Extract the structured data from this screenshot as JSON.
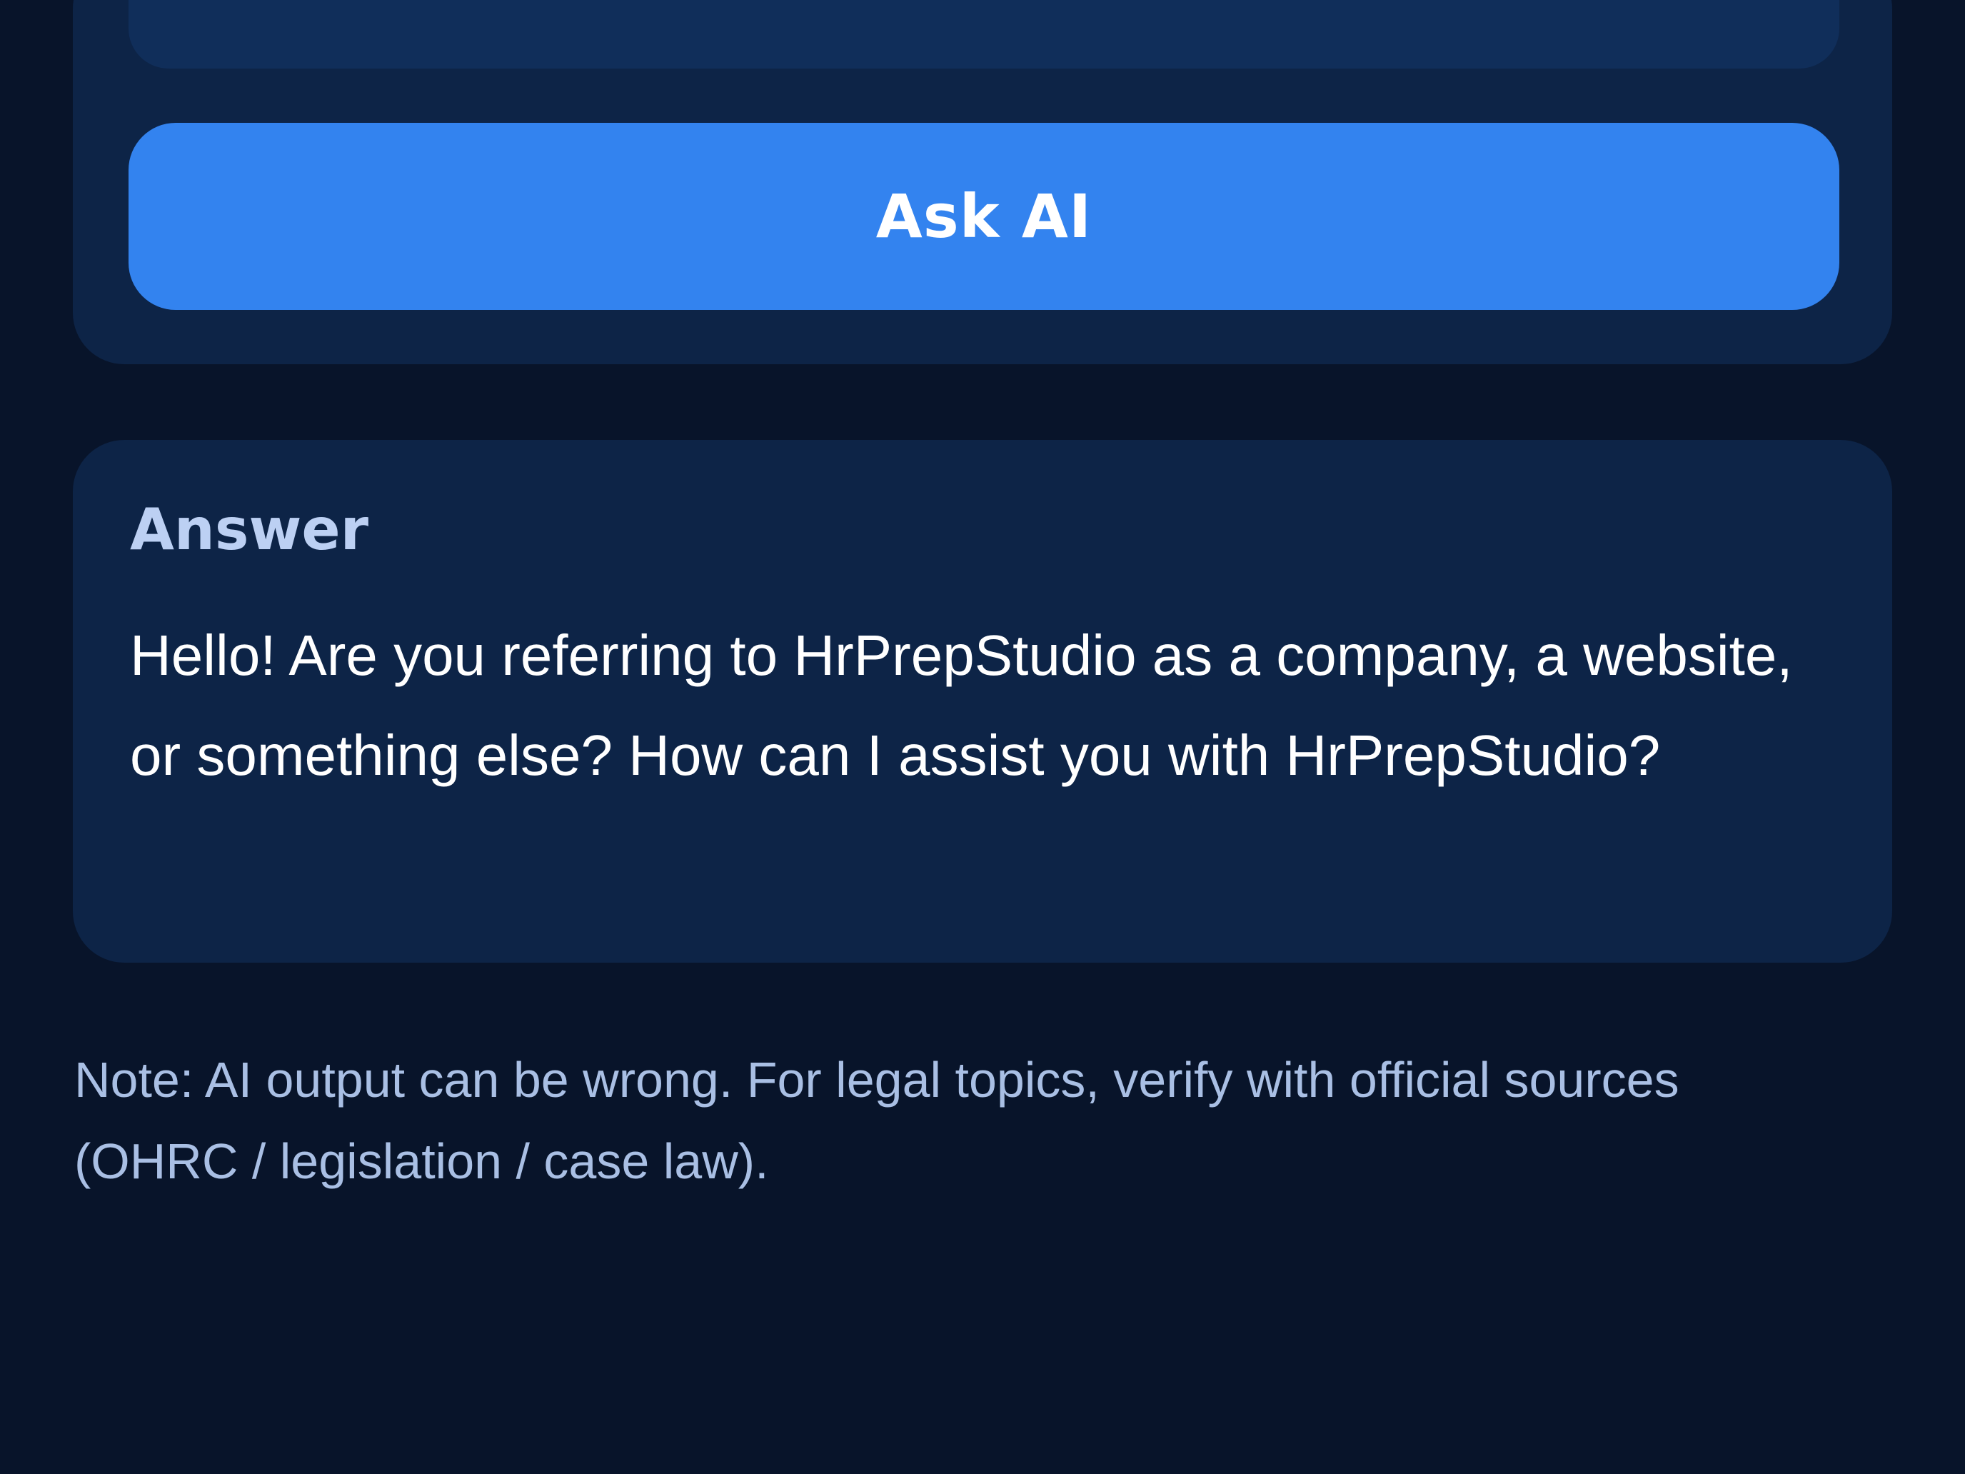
{
  "ask_panel": {
    "button_label": "Ask AI"
  },
  "answer_panel": {
    "title": "Answer",
    "text": "Hello! Are you referring to HrPrepStudio as a company, a website, or something else? How can I assist you with HrPrepStudio?"
  },
  "footer": {
    "note": "Note: AI output can be wrong. For legal topics, verify with official sources (OHRC / legislation / case law)."
  },
  "colors": {
    "background": "#08142a",
    "card": "#0d2447",
    "input": "#102e5a",
    "accent": "#3383ef",
    "title": "#bcd0f3",
    "note": "#a9bfe4"
  }
}
